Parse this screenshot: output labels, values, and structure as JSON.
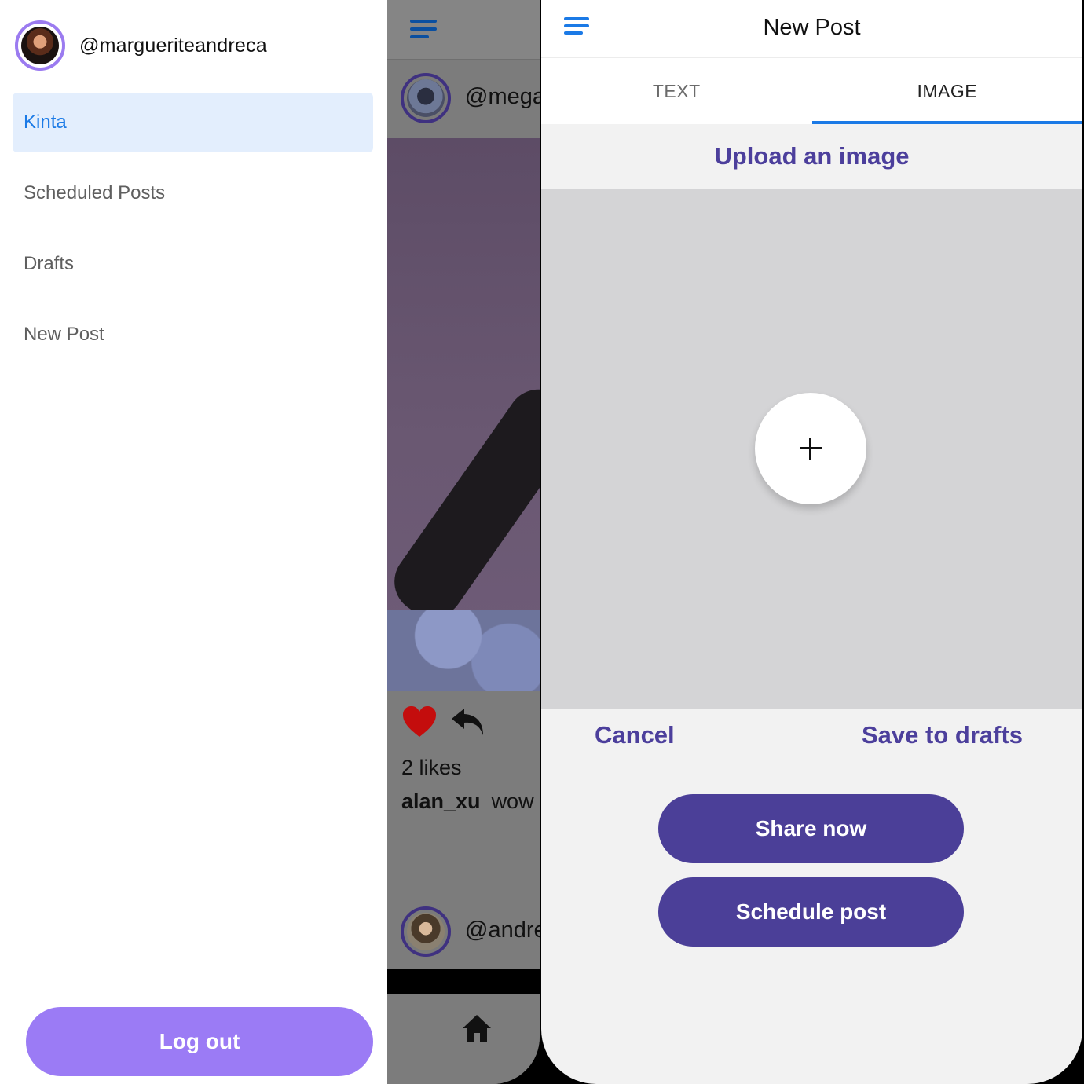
{
  "drawer": {
    "username": "@margueriteandreca",
    "menu": [
      {
        "label": "Kinta",
        "active": true
      },
      {
        "label": "Scheduled Posts",
        "active": false
      },
      {
        "label": "Drafts",
        "active": false
      },
      {
        "label": "New Post",
        "active": false
      }
    ],
    "logout_label": "Log out"
  },
  "feed": {
    "post_handle": "@mega",
    "likes": "2 likes",
    "caption_user": "alan_xu",
    "caption_text": "wow",
    "next_post_handle": "@andre"
  },
  "new_post": {
    "title": "New Post",
    "tabs": [
      {
        "label": "TEXT",
        "active": false
      },
      {
        "label": "IMAGE",
        "active": true
      }
    ],
    "upload_title": "Upload an image",
    "cancel_label": "Cancel",
    "save_drafts_label": "Save to drafts",
    "share_now_label": "Share now",
    "schedule_label": "Schedule post"
  },
  "colors": {
    "accent_blue": "#1b7ae6",
    "brand_purple": "#4b3f98",
    "logout_purple": "#9b7bf5",
    "heart_red": "#c40d0d"
  },
  "icons": [
    "hamburger-icon",
    "heart-icon",
    "reply-icon",
    "home-icon",
    "plus-icon"
  ]
}
